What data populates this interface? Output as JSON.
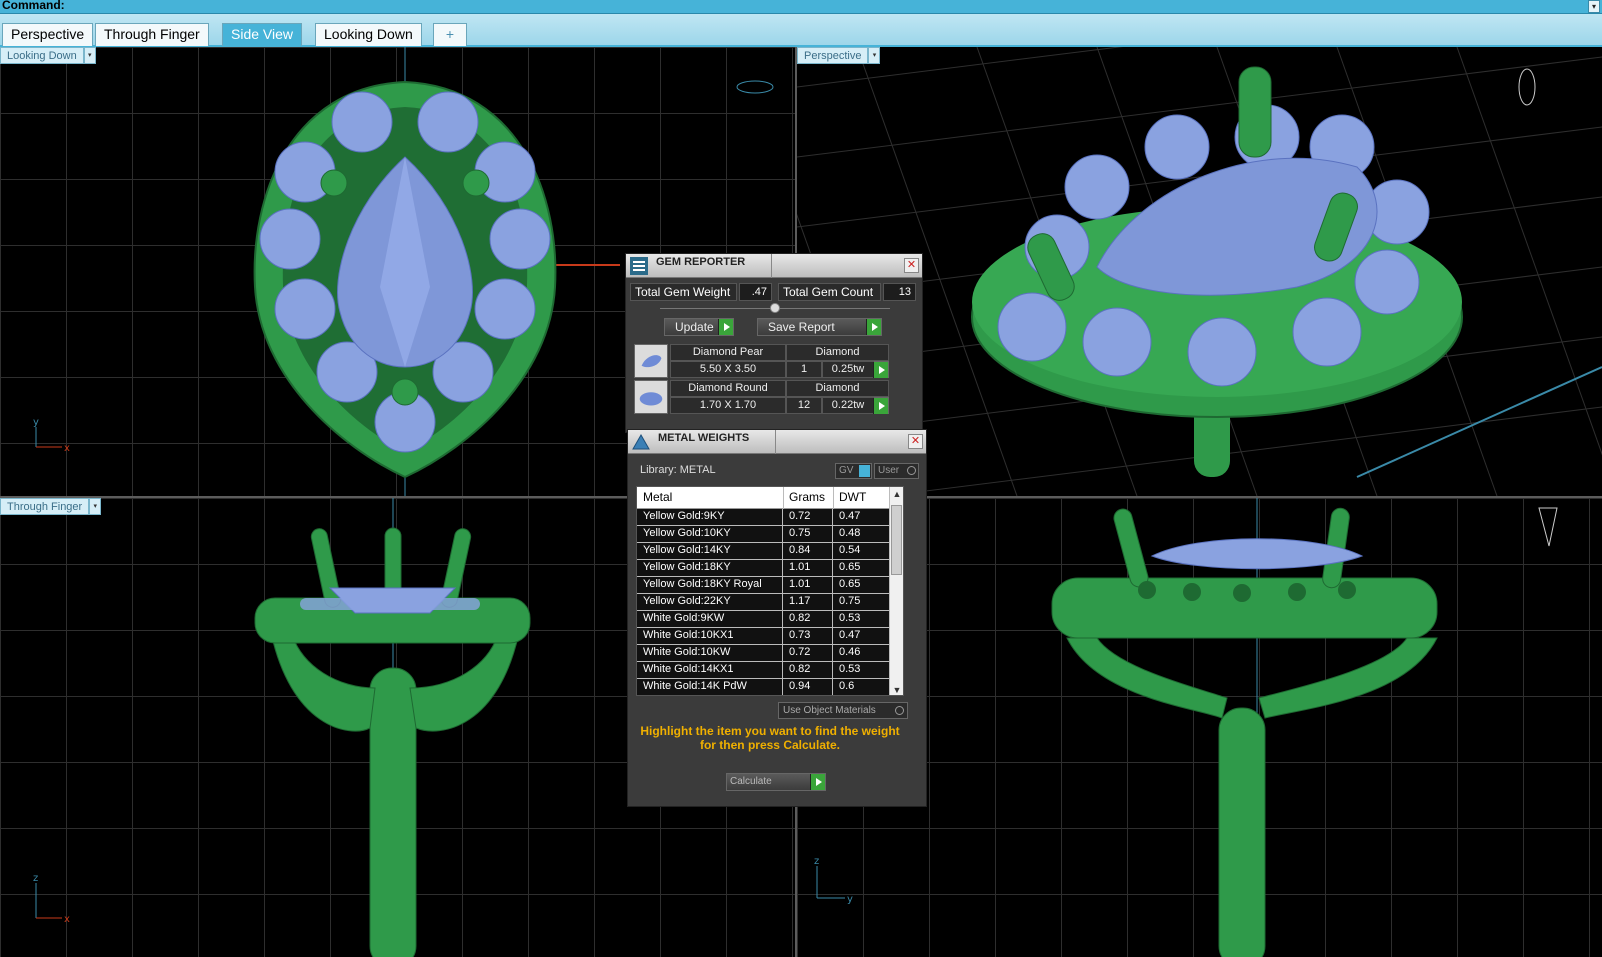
{
  "command_bar": {
    "label": "Command:"
  },
  "tabs": [
    {
      "label": "Perspective",
      "active": false
    },
    {
      "label": "Through Finger",
      "active": false
    },
    {
      "label": "Side View",
      "active": true
    },
    {
      "label": "Looking Down",
      "active": false
    },
    {
      "label": "+",
      "active": false
    }
  ],
  "viewports": {
    "top_left": {
      "label": "Looking Down",
      "axis_a": "y",
      "axis_b": "x"
    },
    "top_right": {
      "label": "Perspective"
    },
    "bottom_left": {
      "label": "Through Finger",
      "axis_a": "z",
      "axis_b": "x"
    },
    "bottom_right": {
      "label": "",
      "axis_a": "z",
      "axis_b": "y"
    }
  },
  "gem_reporter": {
    "title": "GEM REPORTER",
    "total_gem_weight_label": "Total Gem Weight",
    "total_gem_weight": ".47",
    "total_gem_count_label": "Total Gem Count",
    "total_gem_count": "13",
    "update_label": "Update",
    "save_report_label": "Save Report",
    "gems": [
      {
        "name": "Diamond Pear",
        "material": "Diamond",
        "size": "5.50 X 3.50",
        "count": "1",
        "weight": "0.25tw"
      },
      {
        "name": "Diamond Round",
        "material": "Diamond",
        "size": "1.70 X 1.70",
        "count": "12",
        "weight": "0.22tw"
      }
    ]
  },
  "metal_weights": {
    "title": "METAL WEIGHTS",
    "library_label": "Library: METAL",
    "gv_label": "GV",
    "user_label": "User",
    "columns": [
      "Metal",
      "Grams",
      "DWT"
    ],
    "rows": [
      [
        "Yellow Gold:9KY",
        "0.72",
        "0.47"
      ],
      [
        "Yellow Gold:10KY",
        "0.75",
        "0.48"
      ],
      [
        "Yellow Gold:14KY",
        "0.84",
        "0.54"
      ],
      [
        "Yellow Gold:18KY",
        "1.01",
        "0.65"
      ],
      [
        "Yellow Gold:18KY Royal",
        "1.01",
        "0.65"
      ],
      [
        "Yellow Gold:22KY",
        "1.17",
        "0.75"
      ],
      [
        "White Gold:9KW",
        "0.82",
        "0.53"
      ],
      [
        "White Gold:10KX1",
        "0.73",
        "0.47"
      ],
      [
        "White Gold:10KW",
        "0.72",
        "0.46"
      ],
      [
        "White Gold:14KX1",
        "0.82",
        "0.53"
      ],
      [
        "White Gold:14K PdW",
        "0.94",
        "0.6"
      ]
    ],
    "use_object_materials_label": "Use Object Materials",
    "hint_line1": "Highlight the item you want to find the weight",
    "hint_line2": "for then press Calculate.",
    "calculate_label": "Calculate"
  },
  "colors": {
    "metal_green": "#2f9a4a",
    "gem_blue": "#8aa2e0",
    "accent_blue": "#46b3d8",
    "hint_yellow": "#f0b000"
  }
}
